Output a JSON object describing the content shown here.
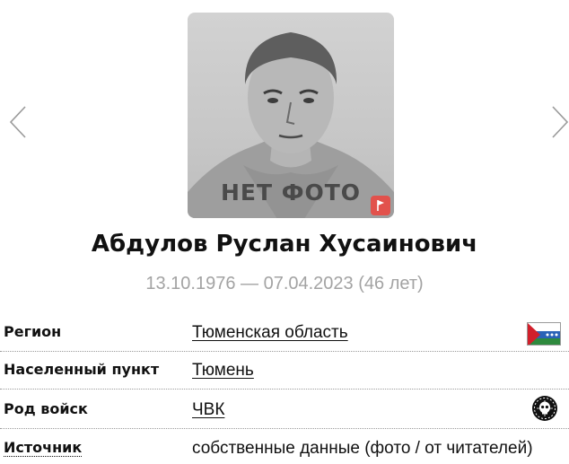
{
  "profile": {
    "photo_placeholder": "НЕТ ФОТО",
    "name": "Абдулов Руслан Хусаинович",
    "dates": "13.10.1976 — 07.04.2023 (46 лет)"
  },
  "details": [
    {
      "label": "Регион",
      "value": "Тюменская область",
      "value_is_link": true,
      "icon": "tyumen-region-flag-icon"
    },
    {
      "label": "Населенный пункт",
      "value": "Тюмень",
      "value_is_link": true
    },
    {
      "label": "Род войск",
      "value": "ЧВК",
      "value_is_link": true,
      "icon": "wagner-skull-emblem-icon"
    },
    {
      "label": "Источник",
      "value": "собственные данные (фото / от читателей)",
      "value_is_link": false
    }
  ],
  "icons": {
    "prev": "chevron-left-icon",
    "next": "chevron-right-icon",
    "report": "flag-icon"
  },
  "colors": {
    "name_text": "#111111",
    "dates_text": "#a3a3a3",
    "badge": "#e2524c",
    "placeholder_text": "#4a4a4a"
  }
}
